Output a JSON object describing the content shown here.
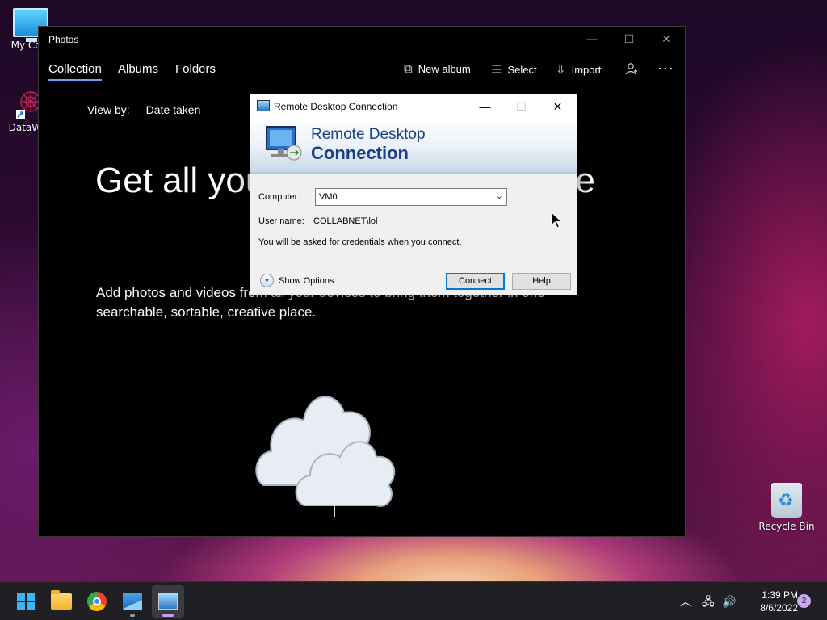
{
  "desktop": {
    "icons": [
      {
        "label": "My Com"
      },
      {
        "label": "DataWag"
      },
      {
        "label": "Recycle Bin"
      }
    ]
  },
  "photos": {
    "title": "Photos",
    "window_controls": {
      "minimize": "—",
      "maximize": "☐",
      "close": "✕"
    },
    "tabs": [
      {
        "label": "Collection",
        "active": true
      },
      {
        "label": "Albums",
        "active": false
      },
      {
        "label": "Folders",
        "active": false
      }
    ],
    "toolbar": {
      "new_album": "New album",
      "select": "Select",
      "import": "Import",
      "more": "···"
    },
    "view_by": {
      "label": "View by:",
      "value": "Date taken"
    },
    "hero": {
      "title": "Get all your photos in one place",
      "subtitle": "Add photos and videos from all your devices to bring them together in one searchable, sortable, creative place."
    }
  },
  "rdp": {
    "title": "Remote Desktop Connection",
    "banner_line1": "Remote Desktop",
    "banner_line2": "Connection",
    "computer_label": "Computer:",
    "computer_value": "VM0",
    "username_label": "User name:",
    "username_value": "COLLABNET\\lol",
    "note": "You will be asked for credentials when you connect.",
    "show_options": "Show Options",
    "connect": "Connect",
    "help": "Help"
  },
  "taskbar": {
    "apps": [
      "start",
      "file-explorer",
      "chrome",
      "photos",
      "remote-desktop"
    ],
    "time": "1:39 PM",
    "date": "8/6/2022",
    "notifications": "2"
  },
  "colors": {
    "accent": "#7a9cff",
    "rdp_banner_text": "#1b3f84",
    "start_blue": "#3fb4f4"
  }
}
